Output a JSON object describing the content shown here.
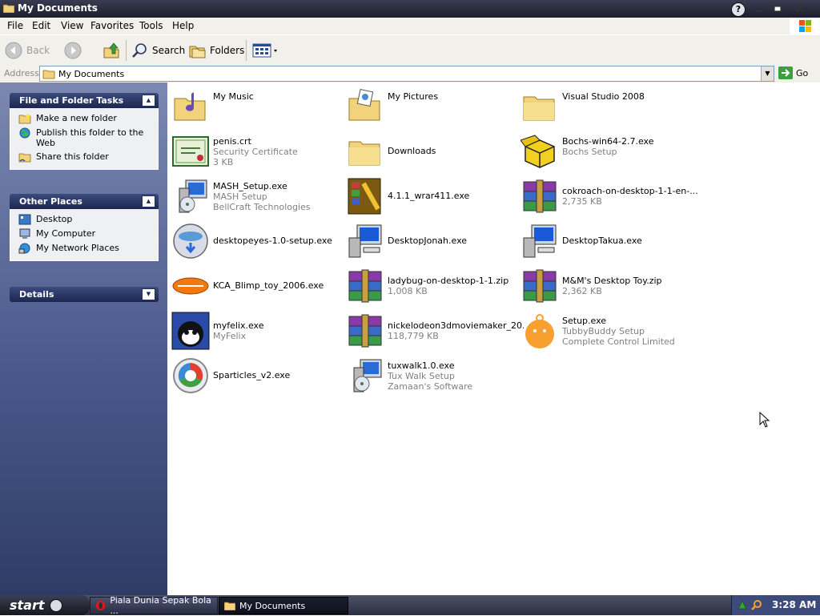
{
  "window": {
    "title": "My Documents"
  },
  "menu": [
    "File",
    "Edit",
    "View",
    "Favorites",
    "Tools",
    "Help"
  ],
  "toolbar": {
    "back": "Back",
    "search": "Search",
    "folders": "Folders"
  },
  "address": {
    "label": "Address",
    "value": "My Documents",
    "go": "Go"
  },
  "sidebar": {
    "file_tasks": {
      "title": "File and Folder Tasks",
      "items": [
        "Make a new folder",
        "Publish this folder to the Web",
        "Share this folder"
      ]
    },
    "other_places": {
      "title": "Other Places",
      "items": [
        "Desktop",
        "My Computer",
        "My Network Places"
      ]
    },
    "details": {
      "title": "Details"
    }
  },
  "items": [
    {
      "name": "My Music",
      "icon": "music-folder-icon"
    },
    {
      "name": "My Pictures",
      "icon": "pictures-folder-icon"
    },
    {
      "name": "Visual Studio 2008",
      "icon": "folder-icon"
    },
    {
      "name": "penis.crt",
      "line2": "Security Certificate",
      "line3": "3 KB",
      "icon": "certificate-icon"
    },
    {
      "name": "Downloads",
      "icon": "folder-icon"
    },
    {
      "name": "Bochs-win64-2.7.exe",
      "line2": "Bochs Setup",
      "icon": "open-box-icon"
    },
    {
      "name": "MASH_Setup.exe",
      "line2": "MASH Setup",
      "line3": "BellCraft Technologies",
      "icon": "installer-icon"
    },
    {
      "name": "4.1.1_wrar411.exe",
      "icon": "winrar-installer-icon"
    },
    {
      "name": "cokroach-on-desktop-1-1-en-...",
      "line2": "2,735 KB",
      "icon": "rar-archive-icon"
    },
    {
      "name": "desktopeyes-1.0-setup.exe",
      "icon": "nsis-installer-icon"
    },
    {
      "name": "DesktopJonah.exe",
      "icon": "setup-computer-icon"
    },
    {
      "name": "DesktopTakua.exe",
      "icon": "setup-computer-icon"
    },
    {
      "name": "KCA_Blimp_toy_2006.exe",
      "icon": "nickelodeon-blimp-icon"
    },
    {
      "name": "ladybug-on-desktop-1-1.zip",
      "line2": "1,008 KB",
      "icon": "rar-archive-icon"
    },
    {
      "name": "M&M's Desktop Toy.zip",
      "line2": "2,362 KB",
      "icon": "rar-archive-icon"
    },
    {
      "name": "myfelix.exe",
      "line2": "MyFelix",
      "icon": "felix-cat-icon"
    },
    {
      "name": "nickelodeon3dmoviemaker_20...",
      "line2": "118,779 KB",
      "icon": "rar-archive-icon"
    },
    {
      "name": "Setup.exe",
      "line2": "TubbyBuddy Setup",
      "line3": "Complete Control Limited",
      "icon": "tubbybuddy-icon"
    },
    {
      "name": "Sparticles_v2.exe",
      "icon": "sparticles-ball-icon"
    },
    {
      "name": "tuxwalk1.0.exe",
      "line2": "Tux Walk Setup",
      "line3": "Zamaan's Software",
      "icon": "installer-icon"
    }
  ],
  "taskbar": {
    "start": "start",
    "buttons": [
      "Piala Dunia Sepak Bola ...",
      "My Documents"
    ],
    "clock": "3:28 AM"
  }
}
